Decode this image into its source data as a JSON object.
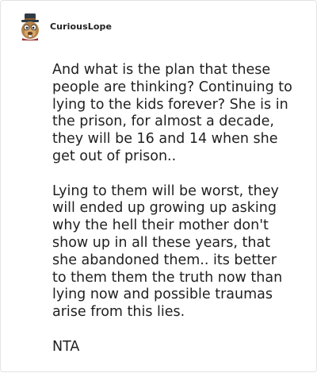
{
  "post": {
    "username": "CuriousLope",
    "avatar_icon": "hat-wearing-cartoon-creature-avatar",
    "paragraphs": [
      "And what is the plan that these people are thinking? Continuing to lying to the kids forever? She is in the prison, for almost a decade, they will be 16 and 14 when she get out of prison..",
      "Lying to them will be worst, they will ended up growing up asking why the hell their mother don't show up in all these years, that she abandoned them.. its better to them them the truth now than lying now and possible traumas arise from this lies.",
      "NTA"
    ]
  }
}
